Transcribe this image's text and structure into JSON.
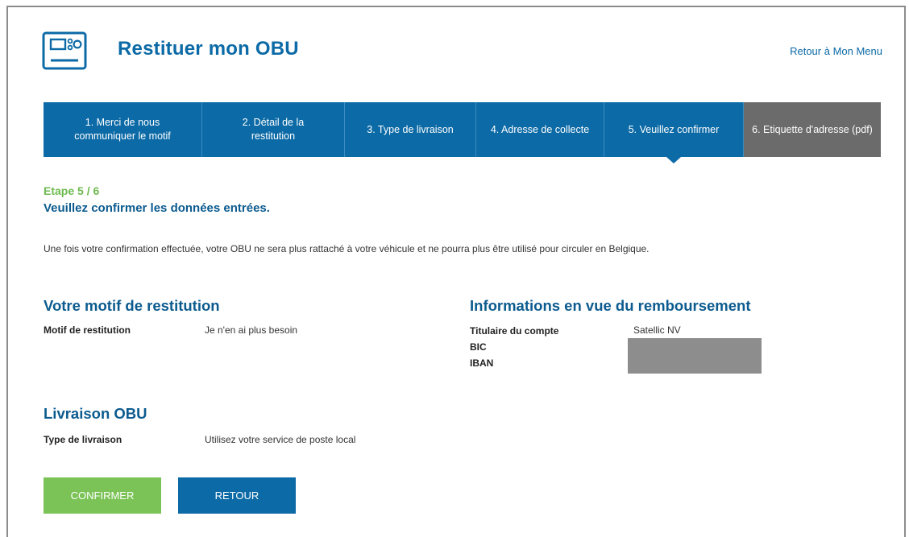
{
  "header": {
    "title": "Restituer mon OBU",
    "menu_link": "Retour à Mon Menu",
    "icon": "obu-device-icon"
  },
  "steps": [
    {
      "label": "1. Merci de nous communiquer le motif"
    },
    {
      "label": "2. Détail de la restitution"
    },
    {
      "label": "3. Type de livraison"
    },
    {
      "label": "4. Adresse de collecte"
    },
    {
      "label": "5. Veuillez confirmer"
    },
    {
      "label": "6. Etiquette d'adresse (pdf)"
    }
  ],
  "progress": {
    "etape": "Etape 5 / 6",
    "subtitle": "Veuillez confirmer les données entrées.",
    "notice": "Une fois votre confirmation effectuée, votre OBU ne sera plus rattaché à votre véhicule et ne pourra plus être utilisé pour circuler en Belgique."
  },
  "motif": {
    "heading": "Votre motif de restitution",
    "label": "Motif de restitution",
    "value": "Je n'en ai plus besoin"
  },
  "remboursement": {
    "heading": "Informations en vue du remboursement",
    "holder_label": "Titulaire du compte",
    "holder_value": "Satellic NV",
    "bic_label": "BIC",
    "iban_label": "IBAN"
  },
  "livraison": {
    "heading": "Livraison OBU",
    "label": "Type de livraison",
    "value": "Utilisez votre service de poste local"
  },
  "buttons": {
    "confirm": "CONFIRMER",
    "retour": "RETOUR"
  },
  "colors": {
    "primary": "#0c6aa6",
    "green": "#7bc356",
    "grey_step": "#6b6b6b"
  }
}
